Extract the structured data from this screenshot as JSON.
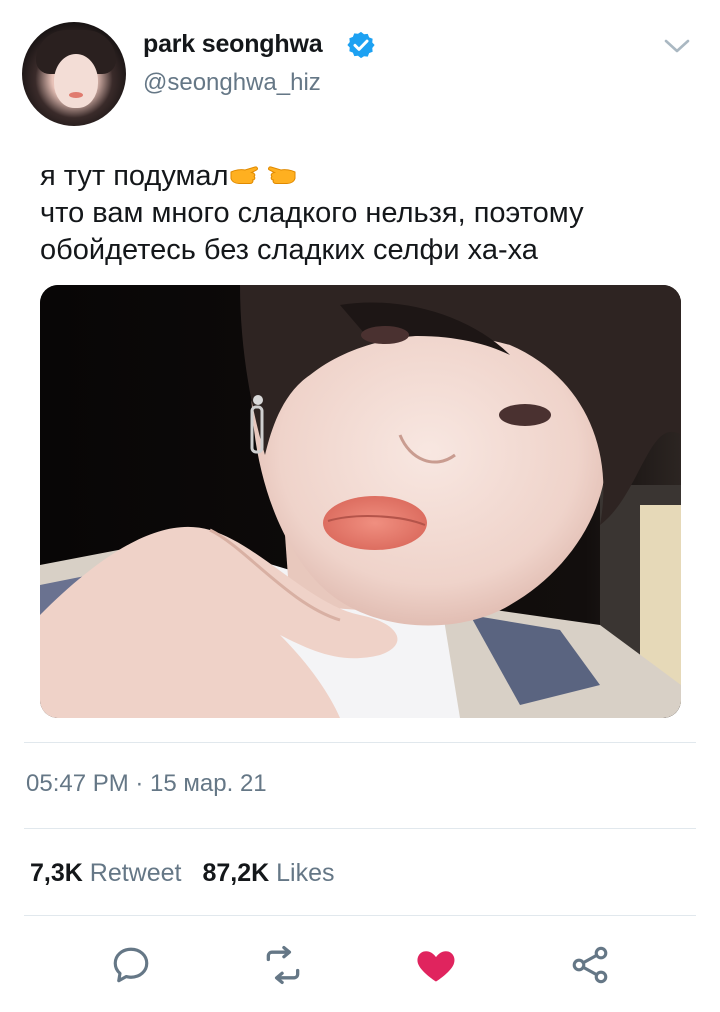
{
  "user": {
    "display_name": "park seonghwa",
    "handle": "@seonghwa_hiz",
    "verified_color": "#1da1f2"
  },
  "tweet": {
    "lines": [
      "я тут подумал",
      "что вам много сладкого нельзя, поэтому",
      "обойдетесь без сладких селфи ха-ха"
    ],
    "emojis": [
      "backhand-index-pointing-right",
      "backhand-index-pointing-left"
    ],
    "timestamp": "05:47 PM · 15 мар. 21"
  },
  "stats": {
    "retweets_count": "7,3K",
    "retweets_label": "Retweet",
    "likes_count": "87,2K",
    "likes_label": "Likes"
  },
  "actions": {
    "reply_icon": "speech-bubble-icon",
    "retweet_icon": "retweet-icon",
    "like_icon": "heart-icon",
    "share_icon": "share-icon",
    "like_color": "#e0245e",
    "icon_color": "#657786"
  }
}
